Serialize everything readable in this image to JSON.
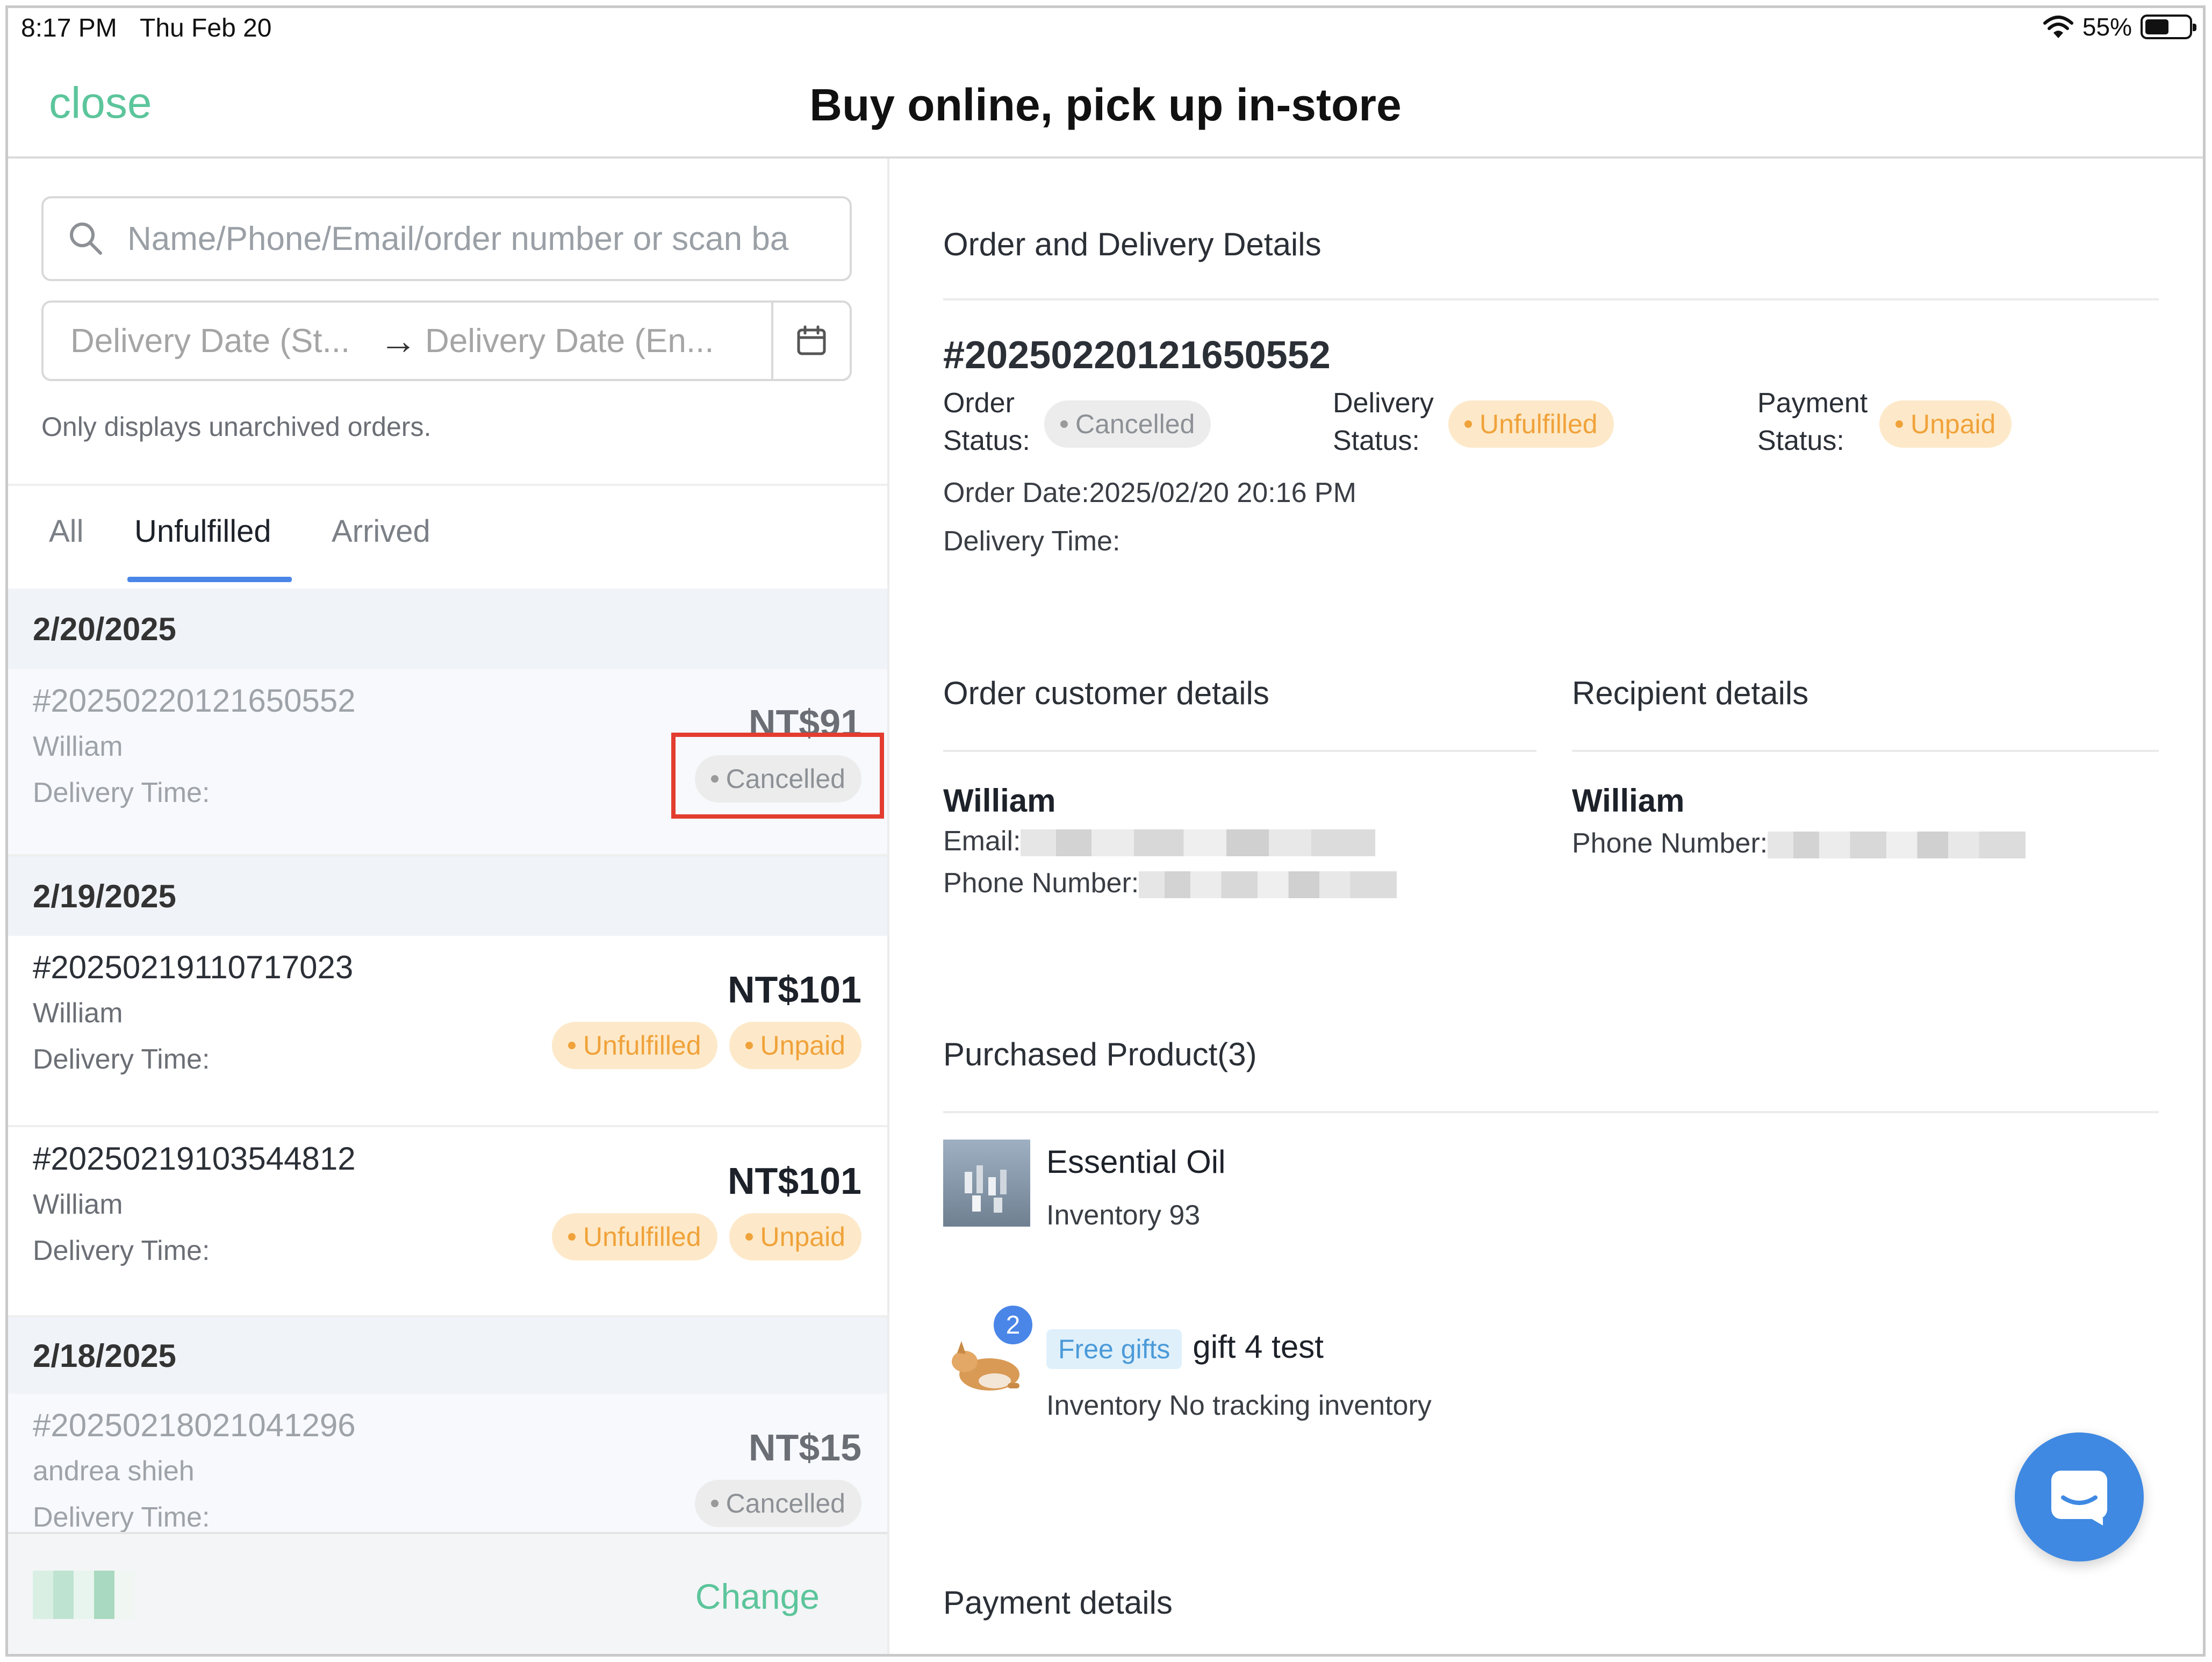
{
  "status_bar": {
    "time": "8:17 PM",
    "date": "Thu Feb 20",
    "battery": "55%",
    "battery_level": 0.55
  },
  "header": {
    "close_label": "close",
    "title": "Buy online, pick up in-store"
  },
  "search": {
    "placeholder": "Name/Phone/Email/order number or scan ba"
  },
  "date_filter": {
    "start_placeholder": "Delivery Date (St...",
    "end_placeholder": "Delivery Date (En..."
  },
  "archived_note": "Only displays unarchived orders.",
  "tabs": [
    {
      "label": "All",
      "active": false
    },
    {
      "label": "Unfulfilled",
      "active": true
    },
    {
      "label": "Arrived",
      "active": false
    }
  ],
  "order_groups": [
    {
      "date": "2/20/2025",
      "orders": [
        {
          "id": "#20250220121650552",
          "customer": "William",
          "delivery_label": "Delivery Time:",
          "price": "NT$91",
          "badges": [
            {
              "text": "Cancelled",
              "color": "grey"
            }
          ]
        }
      ]
    },
    {
      "date": "2/19/2025",
      "orders": [
        {
          "id": "#20250219110717023",
          "customer": "William",
          "delivery_label": "Delivery Time:",
          "price": "NT$101",
          "badges": [
            {
              "text": "Unfulfilled",
              "color": "orange"
            },
            {
              "text": "Unpaid",
              "color": "orange"
            }
          ]
        },
        {
          "id": "#20250219103544812",
          "customer": "William",
          "delivery_label": "Delivery Time:",
          "price": "NT$101",
          "badges": [
            {
              "text": "Unfulfilled",
              "color": "orange"
            },
            {
              "text": "Unpaid",
              "color": "orange"
            }
          ]
        }
      ]
    },
    {
      "date": "2/18/2025",
      "orders": [
        {
          "id": "#20250218021041296",
          "customer": "andrea shieh",
          "delivery_label": "Delivery Time:",
          "price": "NT$15",
          "badges": [
            {
              "text": "Cancelled",
              "color": "grey"
            }
          ]
        }
      ]
    }
  ],
  "footer": {
    "change_label": "Change"
  },
  "detail": {
    "section_title": "Order and Delivery Details",
    "order_id": "#20250220121650552",
    "order_status_label_1": "Order",
    "order_status_label_2": "Status:",
    "order_status": "Cancelled",
    "delivery_status_label_1": "Delivery",
    "delivery_status_label_2": "Status:",
    "delivery_status": "Unfulfilled",
    "payment_status_label_1": "Payment",
    "payment_status_label_2": "Status:",
    "payment_status": "Unpaid",
    "order_date": "Order Date:2025/02/20 20:16 PM",
    "delivery_time": "Delivery Time:"
  },
  "customer": {
    "section_title": "Order customer details",
    "name": "William",
    "email_label": "Email:",
    "phone_label": "Phone Number:"
  },
  "recipient": {
    "section_title": "Recipient details",
    "name": "William",
    "phone_label": "Phone Number:"
  },
  "products": {
    "section_title": "Purchased Product(3)",
    "items": [
      {
        "name": "Essential Oil",
        "inventory": "Inventory 93"
      },
      {
        "tag": "Free gifts",
        "name": "gift 4 test",
        "inventory": "Inventory No tracking inventory",
        "quantity": "2"
      }
    ]
  },
  "payment": {
    "section_title": "Payment details"
  },
  "colors": {
    "accent_green": "#5cc59b",
    "accent_blue": "#4a86e8",
    "pending_orange": "#f0a23a",
    "highlight_red": "#e33d2f"
  }
}
